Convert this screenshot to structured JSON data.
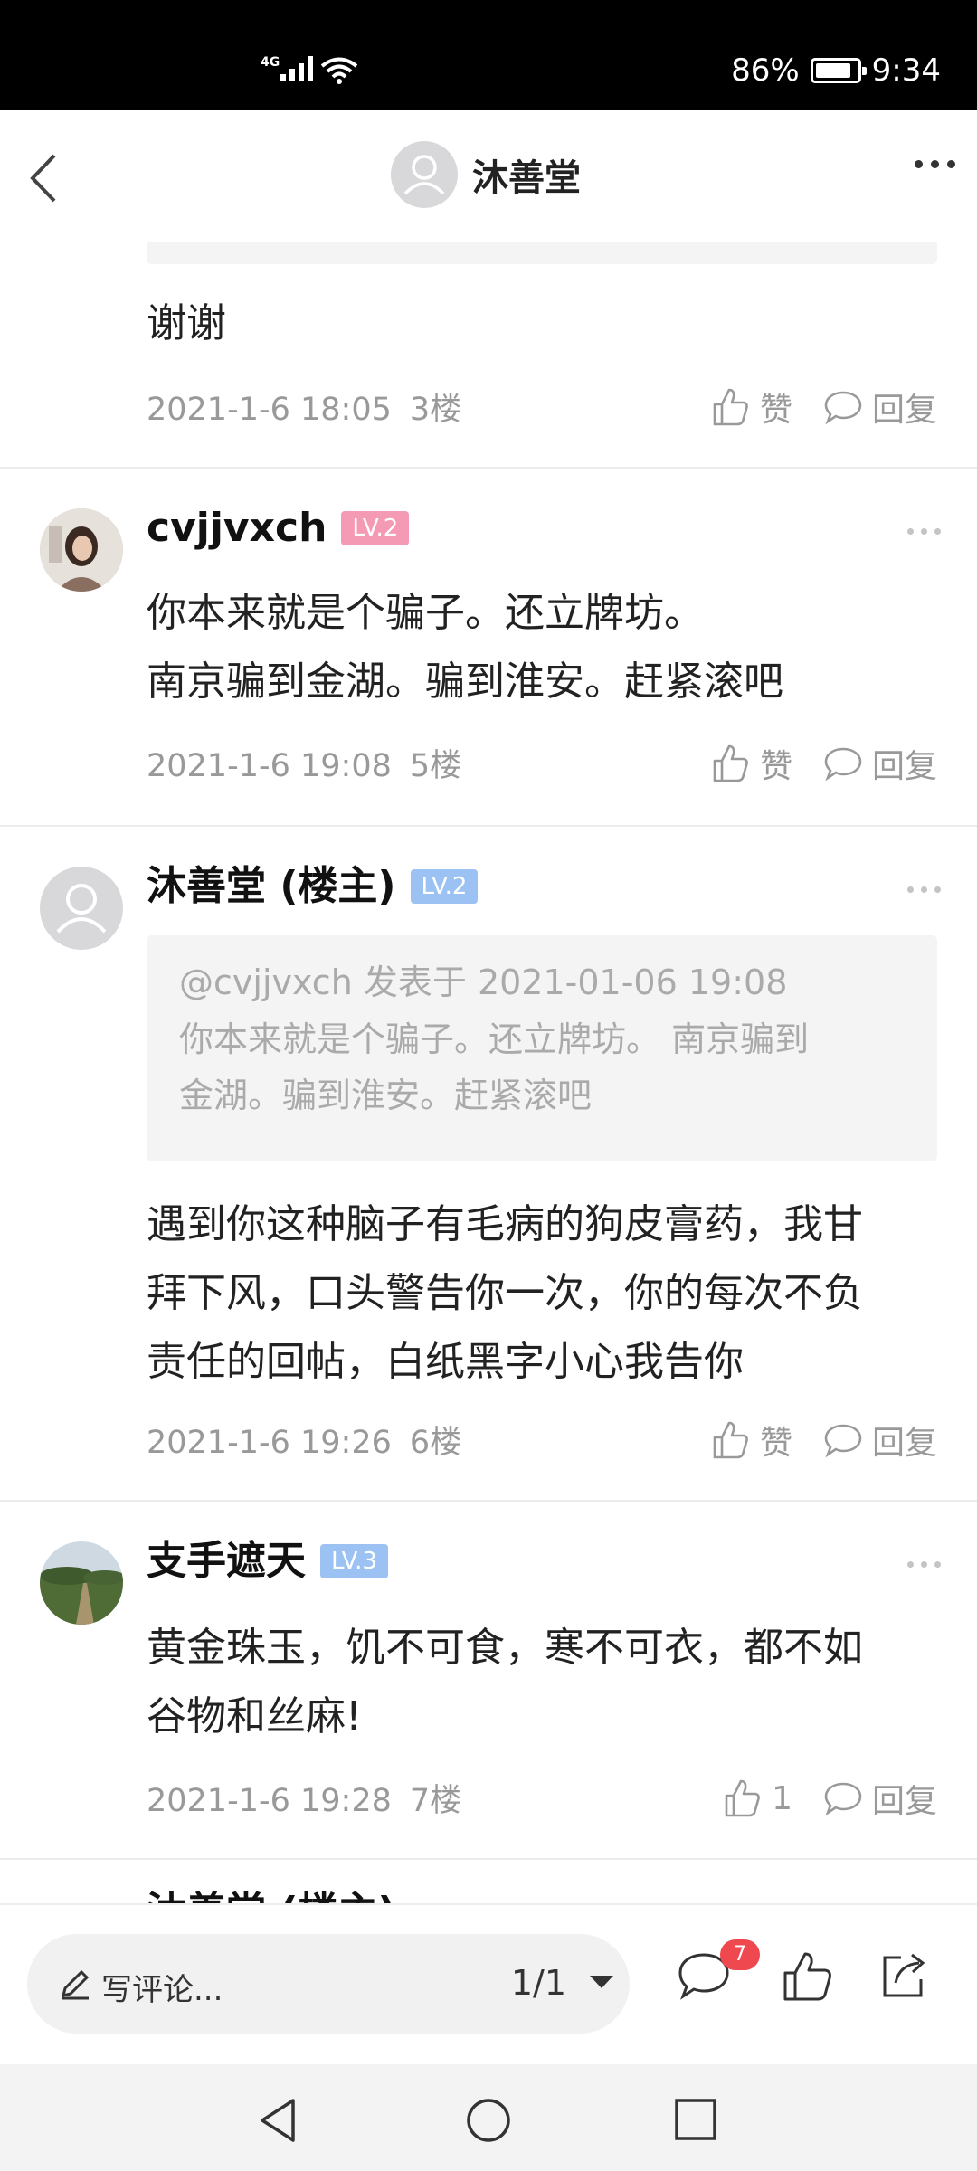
{
  "status_bar": {
    "network": "4G",
    "battery_percent": "86%",
    "time": "9:34"
  },
  "header": {
    "title": "沐善堂"
  },
  "posts": [
    {
      "content": "谢谢",
      "date": "2021-1-6 18:05",
      "floor": "3楼",
      "like_label": "赞",
      "reply_label": "回复"
    },
    {
      "username": "cvjjvxch",
      "level": "LV.2",
      "content_lines": [
        "你本来就是个骗子。还立牌坊。",
        "南京骗到金湖。骗到淮安。赶紧滚吧"
      ],
      "date": "2021-1-6 19:08",
      "floor": "5楼",
      "like_label": "赞",
      "reply_label": "回复"
    },
    {
      "username": "沐善堂 (楼主)",
      "level": "LV.2",
      "quote": {
        "header": "@cvjjvxch 发表于 2021-01-06 19:08",
        "body_lines": [
          "你本来就是个骗子。还立牌坊。 南京骗到",
          "金湖。骗到淮安。赶紧滚吧"
        ]
      },
      "content_lines": [
        "遇到你这种脑子有毛病的狗皮膏药，我甘",
        "拜下风，口头警告你一次，你的每次不负",
        "责任的回帖，白纸黑字小心我告你"
      ],
      "date": "2021-1-6 19:26",
      "floor": "6楼",
      "like_label": "赞",
      "reply_label": "回复"
    },
    {
      "username": "支手遮天",
      "level": "LV.3",
      "content_lines": [
        "黄金珠玉，饥不可食，寒不可衣，都不如",
        "谷物和丝麻!"
      ],
      "date": "2021-1-6 19:28",
      "floor": "7楼",
      "like_count": "1",
      "reply_label": "回复"
    }
  ],
  "next_post_cutoff": "沐善堂 (楼主)",
  "bottom_bar": {
    "comment_placeholder": "写评论...",
    "page_indicator": "1/1",
    "comment_count": "7"
  },
  "colors": {
    "level_pink": "#f49ab5",
    "level_blue": "#9bc2f3",
    "badge_red": "#f0484f"
  }
}
